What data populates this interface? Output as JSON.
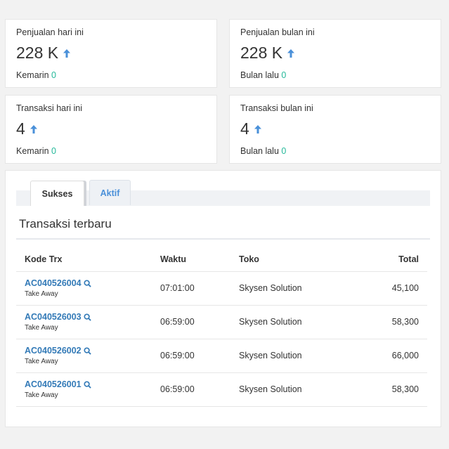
{
  "stats": [
    {
      "title": "Penjualan hari ini",
      "value": "228 K",
      "foot_label": "Kemarin",
      "foot_value": "0"
    },
    {
      "title": "Penjualan bulan ini",
      "value": "228 K",
      "foot_label": "Bulan lalu",
      "foot_value": "0"
    },
    {
      "title": "Transaksi hari ini",
      "value": "4",
      "foot_label": "Kemarin",
      "foot_value": "0"
    },
    {
      "title": "Transaksi bulan ini",
      "value": "4",
      "foot_label": "Bulan lalu",
      "foot_value": "0"
    }
  ],
  "tabs": [
    {
      "label": "Sukses"
    },
    {
      "label": "Aktif"
    }
  ],
  "section": {
    "title": "Transaksi terbaru"
  },
  "table": {
    "headers": [
      "Kode Trx",
      "Waktu",
      "Toko",
      "Total"
    ],
    "rows": [
      {
        "code": "AC040526004",
        "type": "Take Away",
        "time": "07:01:00",
        "store": "Skysen Solution",
        "total": "45,100"
      },
      {
        "code": "AC040526003",
        "type": "Take Away",
        "time": "06:59:00",
        "store": "Skysen Solution",
        "total": "58,300"
      },
      {
        "code": "AC040526002",
        "type": "Take Away",
        "time": "06:59:00",
        "store": "Skysen Solution",
        "total": "66,000"
      },
      {
        "code": "AC040526001",
        "type": "Take Away",
        "time": "06:59:00",
        "store": "Skysen Solution",
        "total": "58,300"
      }
    ]
  },
  "icons": {
    "trend": "arrow-up-icon",
    "lookup": "search-icon"
  },
  "colors": {
    "accent": "#337ab7",
    "arrow": "#4a90d9",
    "positive": "#26b99a"
  }
}
